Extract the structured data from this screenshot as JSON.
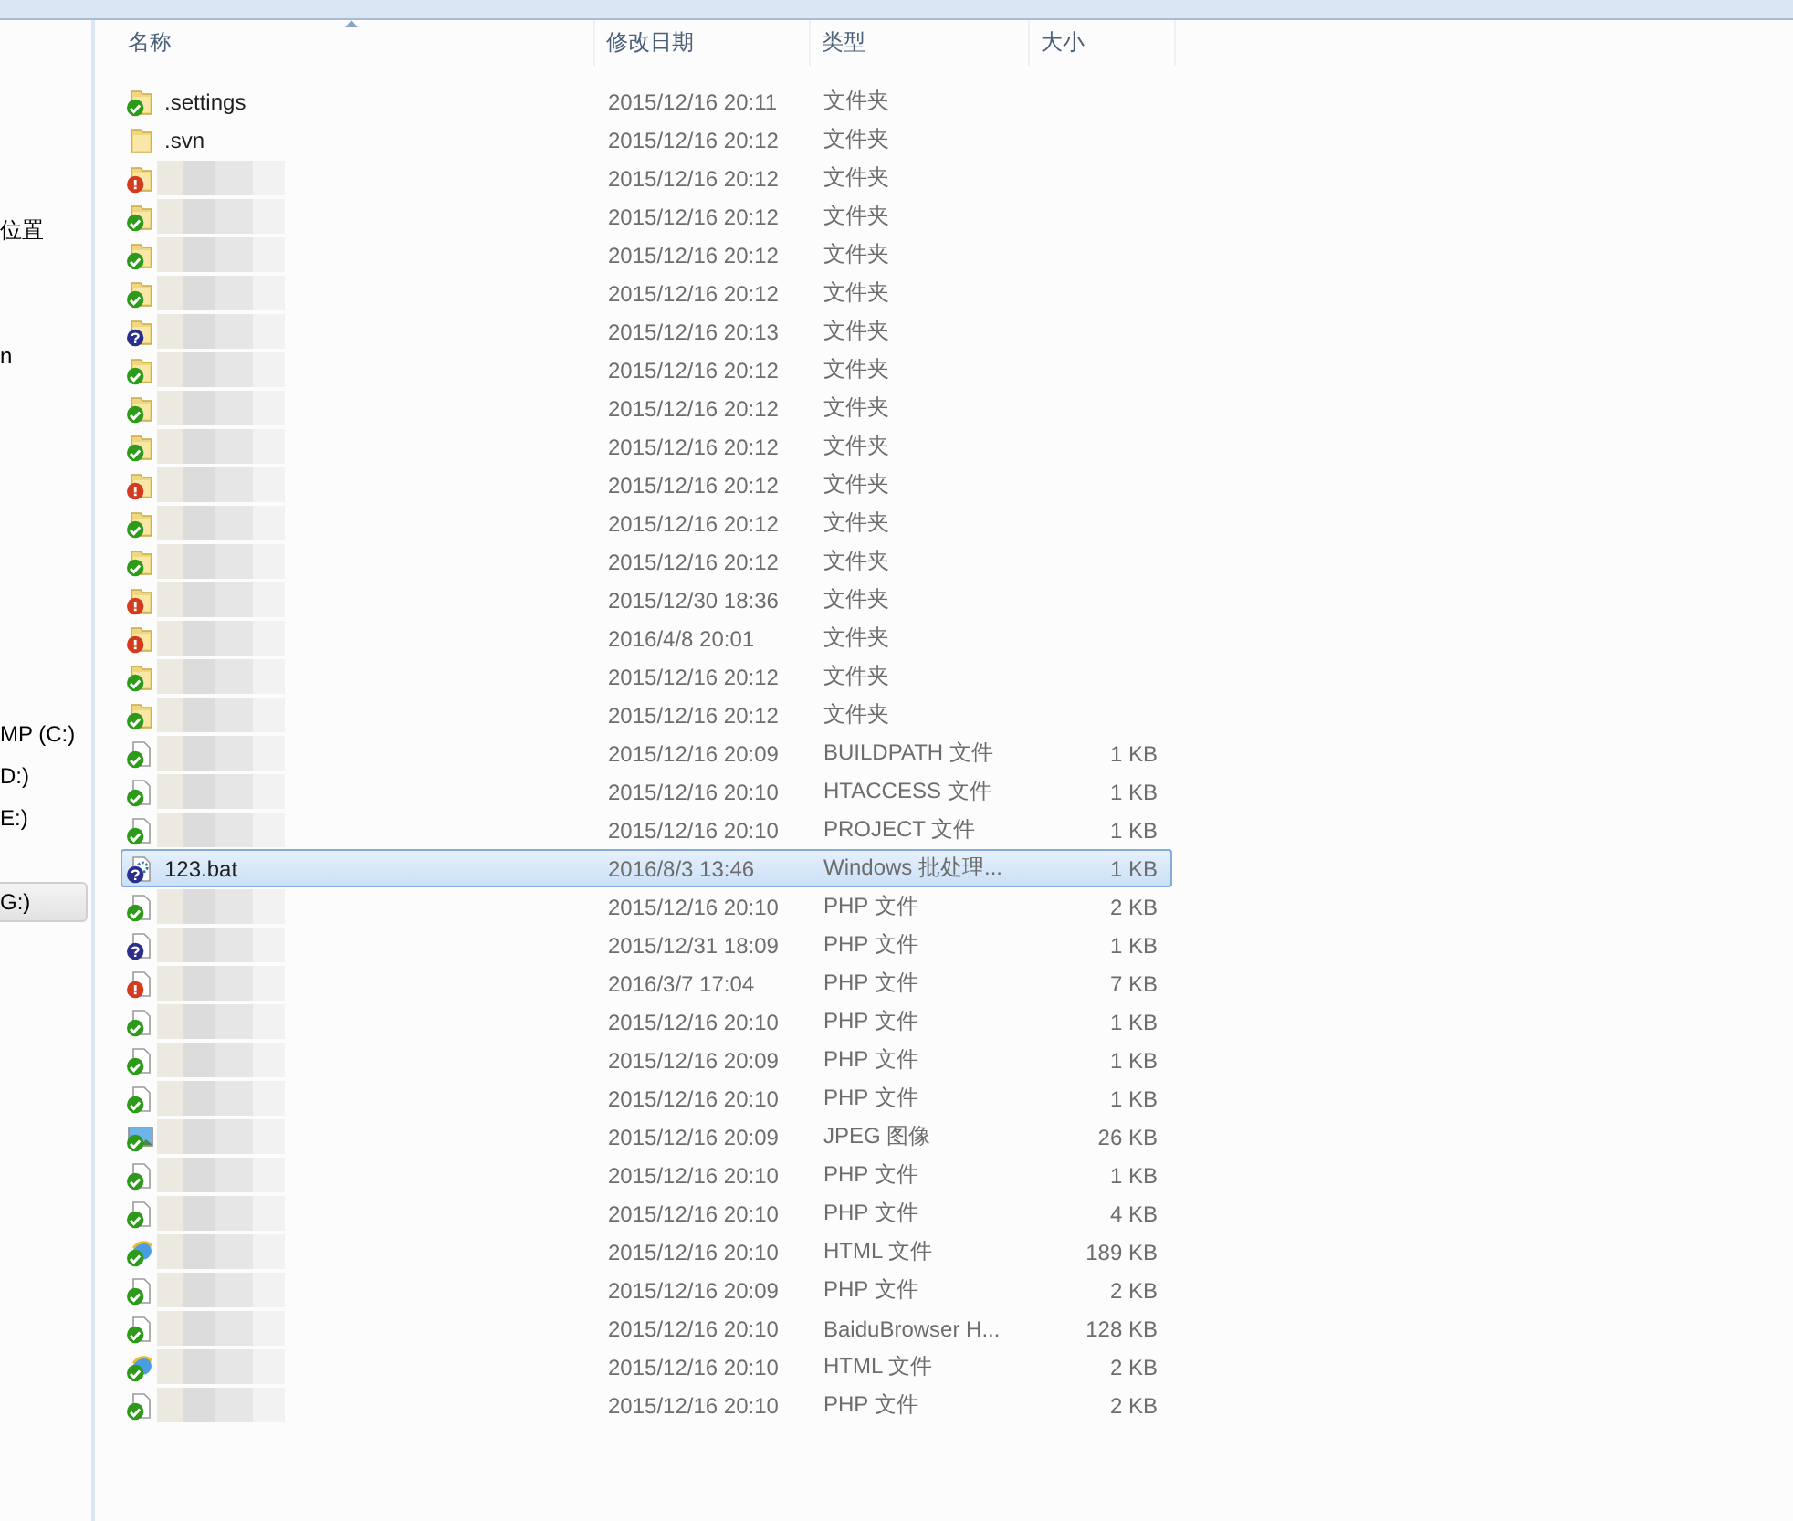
{
  "navigation_pane": {
    "items": [
      {
        "label": "位置",
        "selected": false
      },
      {
        "label": "n",
        "selected": false
      },
      {
        "label": "MP (C:)",
        "selected": false
      },
      {
        "label": "D:)",
        "selected": false
      },
      {
        "label": "E:)",
        "selected": false
      },
      {
        "label": "G:)",
        "selected": true
      }
    ]
  },
  "file_list": {
    "columns": [
      "名称",
      "修改日期",
      "类型",
      "大小"
    ],
    "rows": [
      {
        "name": ".settings",
        "kind": "folder",
        "status_badge": {
          "kind": "check"
        },
        "modified": "2015/12/16 20:11",
        "type": "文件夹",
        "selected": false
      },
      {
        "name": ".svn",
        "kind": "folder",
        "modified": "2015/12/16 20:12",
        "type": "文件夹",
        "selected": false
      },
      {
        "kind": "folder",
        "status_badge": {
          "kind": "exclamation"
        },
        "modified": "2015/12/16 20:12",
        "type": "文件夹",
        "selected": false
      },
      {
        "kind": "folder",
        "status_badge": {
          "kind": "check"
        },
        "modified": "2015/12/16 20:12",
        "type": "文件夹",
        "selected": false
      },
      {
        "kind": "folder",
        "status_badge": {
          "kind": "check"
        },
        "modified": "2015/12/16 20:12",
        "type": "文件夹",
        "selected": false
      },
      {
        "kind": "folder",
        "status_badge": {
          "kind": "check"
        },
        "modified": "2015/12/16 20:12",
        "type": "文件夹",
        "selected": false
      },
      {
        "kind": "folder",
        "status_badge": {
          "kind": "question"
        },
        "modified": "2015/12/16 20:13",
        "type": "文件夹",
        "selected": false
      },
      {
        "kind": "folder",
        "status_badge": {
          "kind": "check"
        },
        "modified": "2015/12/16 20:12",
        "type": "文件夹",
        "selected": false
      },
      {
        "kind": "folder",
        "status_badge": {
          "kind": "check"
        },
        "modified": "2015/12/16 20:12",
        "type": "文件夹",
        "selected": false
      },
      {
        "kind": "folder",
        "status_badge": {
          "kind": "check"
        },
        "modified": "2015/12/16 20:12",
        "type": "文件夹",
        "selected": false
      },
      {
        "kind": "folder",
        "status_badge": {
          "kind": "exclamation"
        },
        "modified": "2015/12/16 20:12",
        "type": "文件夹",
        "selected": false
      },
      {
        "kind": "folder",
        "status_badge": {
          "kind": "check"
        },
        "modified": "2015/12/16 20:12",
        "type": "文件夹",
        "selected": false
      },
      {
        "kind": "folder",
        "status_badge": {
          "kind": "check"
        },
        "modified": "2015/12/16 20:12",
        "type": "文件夹",
        "selected": false
      },
      {
        "kind": "folder",
        "status_badge": {
          "kind": "exclamation"
        },
        "modified": "2015/12/30 18:36",
        "type": "文件夹",
        "selected": false
      },
      {
        "kind": "folder",
        "status_badge": {
          "kind": "exclamation"
        },
        "modified": "2016/4/8 20:01",
        "type": "文件夹",
        "selected": false
      },
      {
        "kind": "folder",
        "status_badge": {
          "kind": "check"
        },
        "modified": "2015/12/16 20:12",
        "type": "文件夹",
        "selected": false
      },
      {
        "kind": "folder",
        "status_badge": {
          "kind": "check"
        },
        "modified": "2015/12/16 20:12",
        "type": "文件夹",
        "selected": false
      },
      {
        "kind": "file",
        "status_badge": {
          "kind": "check"
        },
        "modified": "2015/12/16 20:09",
        "type": "BUILDPATH 文件",
        "size": "1 KB",
        "selected": false
      },
      {
        "kind": "file",
        "status_badge": {
          "kind": "check"
        },
        "modified": "2015/12/16 20:10",
        "type": "HTACCESS 文件",
        "size": "1 KB",
        "selected": false
      },
      {
        "kind": "file",
        "status_badge": {
          "kind": "check"
        },
        "modified": "2015/12/16 20:10",
        "type": "PROJECT 文件",
        "size": "1 KB",
        "selected": false
      },
      {
        "name": "123.bat",
        "kind": "batch",
        "status_badge": {
          "kind": "question"
        },
        "modified": "2016/8/3 13:46",
        "type": "Windows 批处理...",
        "size": "1 KB",
        "selected": true
      },
      {
        "kind": "file",
        "status_badge": {
          "kind": "check"
        },
        "modified": "2015/12/16 20:10",
        "type": "PHP 文件",
        "size": "2 KB",
        "selected": false
      },
      {
        "kind": "file",
        "status_badge": {
          "kind": "question"
        },
        "modified": "2015/12/31 18:09",
        "type": "PHP 文件",
        "size": "1 KB",
        "selected": false
      },
      {
        "kind": "file",
        "status_badge": {
          "kind": "exclamation"
        },
        "modified": "2016/3/7 17:04",
        "type": "PHP 文件",
        "size": "7 KB",
        "selected": false
      },
      {
        "kind": "file",
        "status_badge": {
          "kind": "check"
        },
        "modified": "2015/12/16 20:10",
        "type": "PHP 文件",
        "size": "1 KB",
        "selected": false
      },
      {
        "kind": "file",
        "status_badge": {
          "kind": "check"
        },
        "modified": "2015/12/16 20:09",
        "type": "PHP 文件",
        "size": "1 KB",
        "selected": false
      },
      {
        "kind": "file",
        "status_badge": {
          "kind": "check"
        },
        "modified": "2015/12/16 20:10",
        "type": "PHP 文件",
        "size": "1 KB",
        "selected": false
      },
      {
        "kind": "image",
        "status_badge": {
          "kind": "check"
        },
        "modified": "2015/12/16 20:09",
        "type": "JPEG 图像",
        "size": "26 KB",
        "selected": false
      },
      {
        "kind": "file",
        "status_badge": {
          "kind": "check"
        },
        "modified": "2015/12/16 20:10",
        "type": "PHP 文件",
        "size": "1 KB",
        "selected": false
      },
      {
        "kind": "file",
        "status_badge": {
          "kind": "check"
        },
        "modified": "2015/12/16 20:10",
        "type": "PHP 文件",
        "size": "4 KB",
        "selected": false
      },
      {
        "kind": "web",
        "status_badge": {
          "kind": "check"
        },
        "modified": "2015/12/16 20:10",
        "type": "HTML 文件",
        "size": "189 KB",
        "selected": false
      },
      {
        "kind": "file",
        "status_badge": {
          "kind": "check"
        },
        "modified": "2015/12/16 20:09",
        "type": "PHP 文件",
        "size": "2 KB",
        "selected": false
      },
      {
        "kind": "file",
        "status_badge": {
          "kind": "check"
        },
        "modified": "2015/12/16 20:10",
        "type": "BaiduBrowser H...",
        "size": "128 KB",
        "selected": false
      },
      {
        "kind": "web",
        "status_badge": {
          "kind": "check"
        },
        "modified": "2015/12/16 20:10",
        "type": "HTML 文件",
        "size": "2 KB",
        "selected": false
      },
      {
        "kind": "file",
        "status_badge": {
          "kind": "check"
        },
        "modified": "2015/12/16 20:10",
        "type": "PHP 文件",
        "size": "2 KB",
        "selected": false
      }
    ]
  }
}
